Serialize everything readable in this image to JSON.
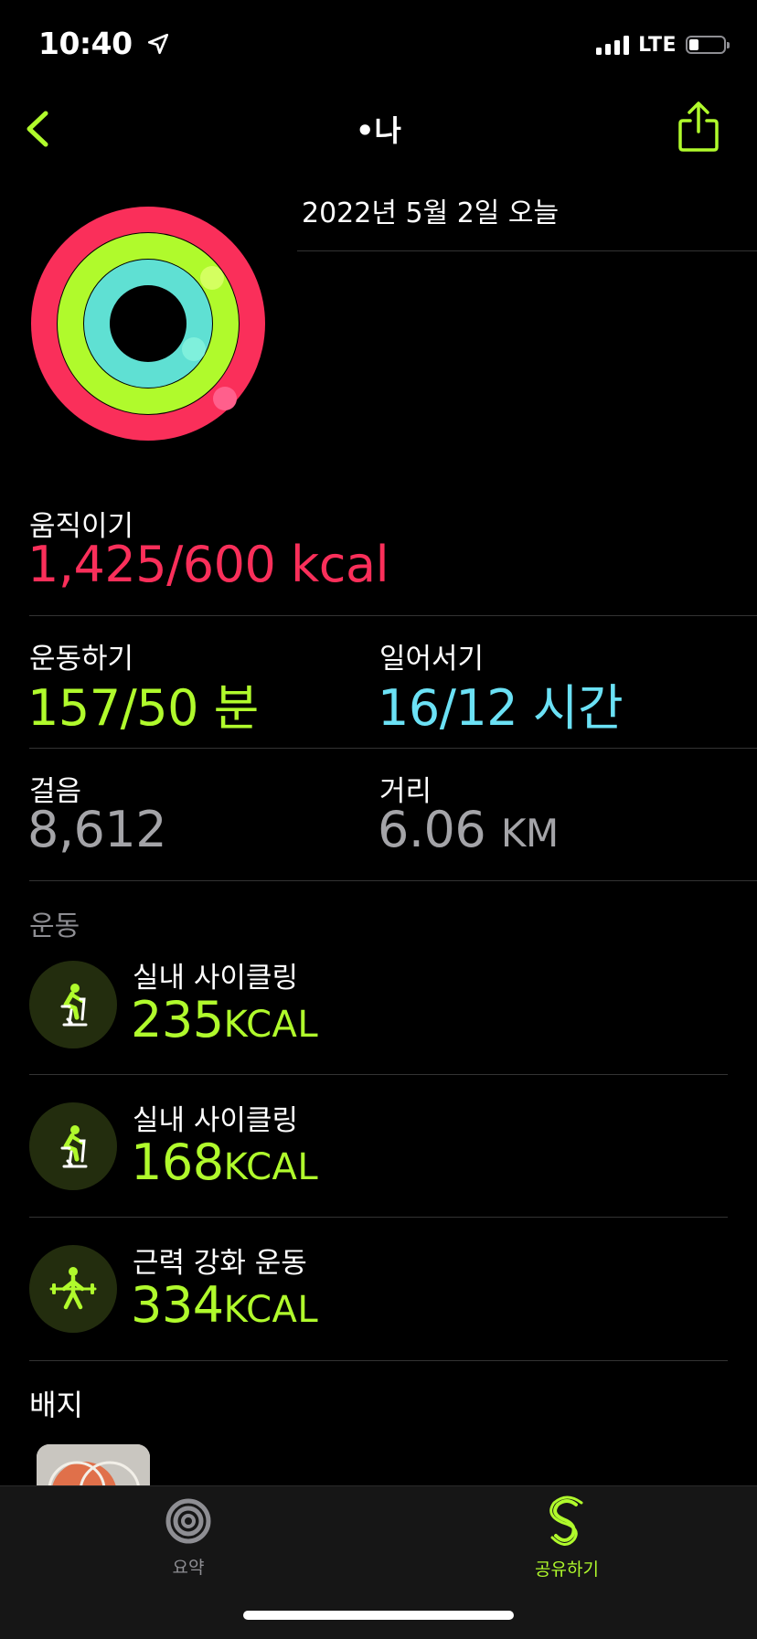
{
  "status_bar": {
    "time": "10:40",
    "network": "LTE"
  },
  "nav": {
    "title": "•나"
  },
  "header": {
    "date": "2022년 5월 2일 오늘"
  },
  "colors": {
    "move": "#fa2f5a",
    "exercise": "#b0fa2c",
    "stand": "#6be1f5",
    "secondary": "#a4a4a8"
  },
  "rings": {
    "move_progress": 2.375,
    "exercise_progress": 3.14,
    "stand_progress": 1.333
  },
  "stats": {
    "move": {
      "label": "움직이기",
      "value": "1,425/600 kcal"
    },
    "exercise": {
      "label": "운동하기",
      "value": "157/50 분"
    },
    "stand": {
      "label": "일어서기",
      "value": "16/12 시간"
    },
    "steps": {
      "label": "걸음",
      "value": "8,612"
    },
    "distance": {
      "label": "거리",
      "value": "6.06",
      "unit": "KM"
    }
  },
  "workouts": {
    "header": "운동",
    "items": [
      {
        "name": "실내 사이클링",
        "value": "235",
        "unit": "KCAL",
        "icon": "indoor-cycle-icon"
      },
      {
        "name": "실내 사이클링",
        "value": "168",
        "unit": "KCAL",
        "icon": "indoor-cycle-icon"
      },
      {
        "name": "근력 강화 운동",
        "value": "334",
        "unit": "KCAL",
        "icon": "strength-training-icon"
      }
    ]
  },
  "badges": {
    "header": "배지"
  },
  "tabbar": {
    "tabs": [
      {
        "label": "요약",
        "icon": "summary-rings-icon",
        "active": false
      },
      {
        "label": "공유하기",
        "icon": "sharing-icon",
        "active": true
      }
    ]
  }
}
